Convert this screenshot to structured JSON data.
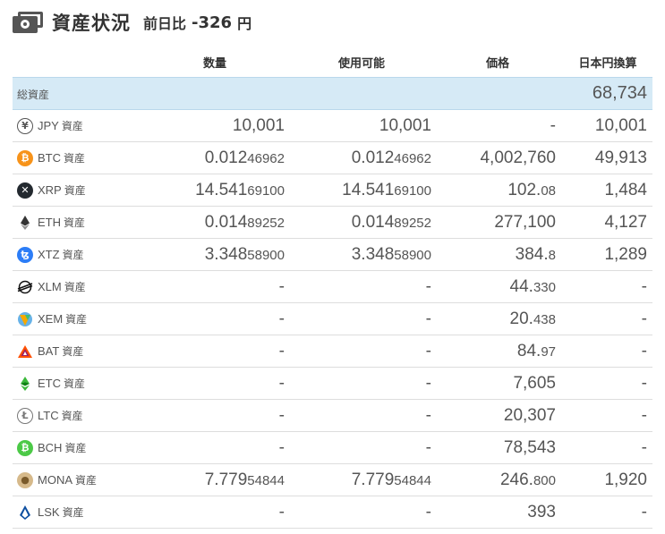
{
  "header": {
    "title": "資産状況",
    "change_label": "前日比",
    "change_value": "-326",
    "change_unit": "円"
  },
  "columns": {
    "quantity": "数量",
    "available": "使用可能",
    "price": "価格",
    "jpy_value": "日本円換算"
  },
  "total": {
    "label": "総資産",
    "value": "68,734"
  },
  "asset_suffix": "資産",
  "rows": [
    {
      "symbol": "JPY",
      "icon": "yen-icon",
      "qty_main": "10,001",
      "qty_small": "",
      "avail_main": "10,001",
      "avail_small": "",
      "price_main": "-",
      "price_small": "",
      "jpy": "10,001"
    },
    {
      "symbol": "BTC",
      "icon": "bitcoin-icon",
      "qty_main": "0.012",
      "qty_small": "46962",
      "avail_main": "0.012",
      "avail_small": "46962",
      "price_main": "4,002,760",
      "price_small": "",
      "jpy": "49,913"
    },
    {
      "symbol": "XRP",
      "icon": "ripple-icon",
      "qty_main": "14.541",
      "qty_small": "69100",
      "avail_main": "14.541",
      "avail_small": "69100",
      "price_main": "102.",
      "price_small": "08",
      "jpy": "1,484"
    },
    {
      "symbol": "ETH",
      "icon": "ethereum-icon",
      "qty_main": "0.014",
      "qty_small": "89252",
      "avail_main": "0.014",
      "avail_small": "89252",
      "price_main": "277,100",
      "price_small": "",
      "jpy": "4,127"
    },
    {
      "symbol": "XTZ",
      "icon": "tezos-icon",
      "qty_main": "3.348",
      "qty_small": "58900",
      "avail_main": "3.348",
      "avail_small": "58900",
      "price_main": "384.",
      "price_small": "8",
      "jpy": "1,289"
    },
    {
      "symbol": "XLM",
      "icon": "stellar-icon",
      "qty_main": "-",
      "qty_small": "",
      "avail_main": "-",
      "avail_small": "",
      "price_main": "44.",
      "price_small": "330",
      "jpy": "-"
    },
    {
      "symbol": "XEM",
      "icon": "nem-icon",
      "qty_main": "-",
      "qty_small": "",
      "avail_main": "-",
      "avail_small": "",
      "price_main": "20.",
      "price_small": "438",
      "jpy": "-"
    },
    {
      "symbol": "BAT",
      "icon": "bat-icon",
      "qty_main": "-",
      "qty_small": "",
      "avail_main": "-",
      "avail_small": "",
      "price_main": "84.",
      "price_small": "97",
      "jpy": "-"
    },
    {
      "symbol": "ETC",
      "icon": "ethereum-classic-icon",
      "qty_main": "-",
      "qty_small": "",
      "avail_main": "-",
      "avail_small": "",
      "price_main": "7,605",
      "price_small": "",
      "jpy": "-"
    },
    {
      "symbol": "LTC",
      "icon": "litecoin-icon",
      "qty_main": "-",
      "qty_small": "",
      "avail_main": "-",
      "avail_small": "",
      "price_main": "20,307",
      "price_small": "",
      "jpy": "-"
    },
    {
      "symbol": "BCH",
      "icon": "bitcoin-cash-icon",
      "qty_main": "-",
      "qty_small": "",
      "avail_main": "-",
      "avail_small": "",
      "price_main": "78,543",
      "price_small": "",
      "jpy": "-"
    },
    {
      "symbol": "MONA",
      "icon": "monacoin-icon",
      "qty_main": "7.779",
      "qty_small": "54844",
      "avail_main": "7.779",
      "avail_small": "54844",
      "price_main": "246.",
      "price_small": "800",
      "jpy": "1,920"
    },
    {
      "symbol": "LSK",
      "icon": "lisk-icon",
      "qty_main": "-",
      "qty_small": "",
      "avail_main": "-",
      "avail_small": "",
      "price_main": "393",
      "price_small": "",
      "jpy": "-"
    }
  ]
}
